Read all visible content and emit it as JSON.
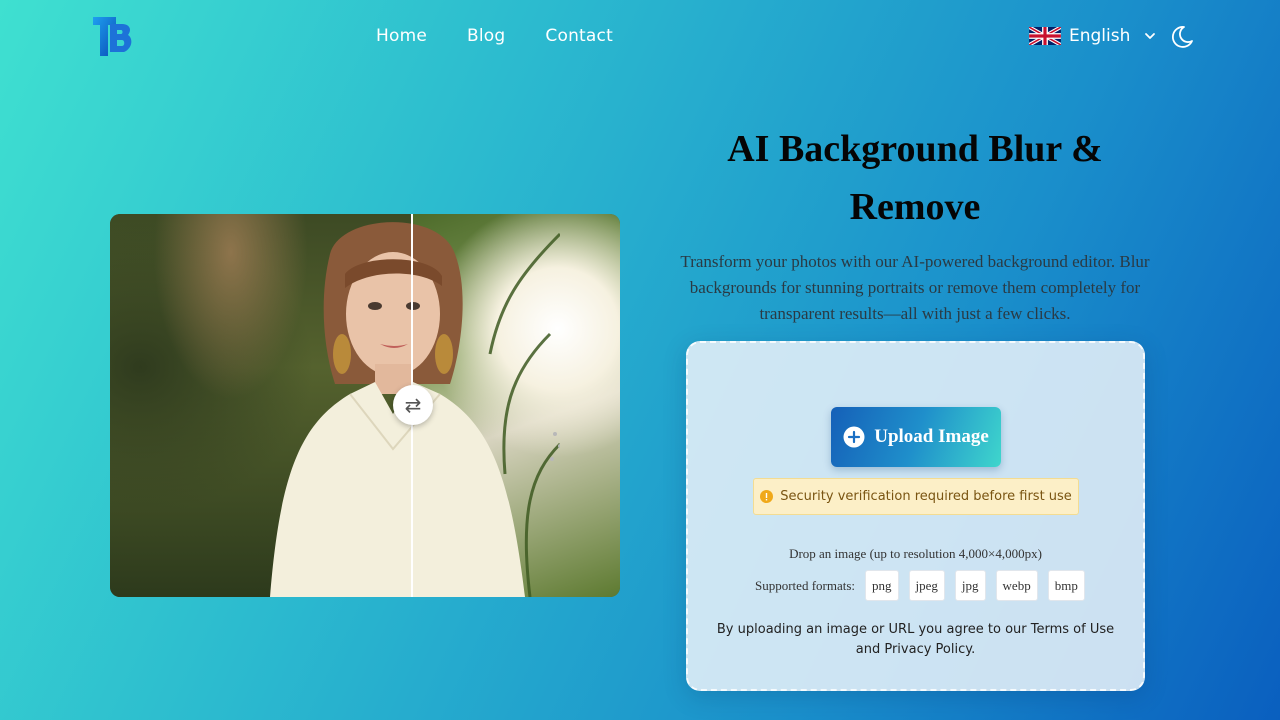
{
  "header": {
    "logo_icon": "tb-logo-icon",
    "nav": [
      {
        "label": "Home"
      },
      {
        "label": "Blog"
      },
      {
        "label": "Contact"
      }
    ],
    "language": {
      "label": "English",
      "flag_icon": "uk-flag-icon"
    },
    "theme_icon": "moon-icon"
  },
  "preview": {
    "swap_icon": "swap-arrows-icon",
    "swap_glyph": "⇄"
  },
  "hero": {
    "title": "AI Background Blur & Remove",
    "description": "Transform your photos with our AI-powered background editor. Blur backgrounds for stunning portraits or remove them completely for transparent results—all with just a few clicks."
  },
  "upload": {
    "button_label": "Upload Image",
    "warning": "Security verification required before first use",
    "drop_text": "Drop an image (up to resolution 4,000×4,000px)",
    "formats_label": "Supported formats:",
    "formats": [
      "png",
      "jpeg",
      "jpg",
      "webp",
      "bmp"
    ],
    "terms": "By uploading an image or URL you agree to our Terms of Use and Privacy Policy."
  },
  "colors": {
    "accent_start": "#1560b8",
    "accent_end": "#3fd6cc",
    "warning_bg": "#fcefc7",
    "warning_text": "#7a5512"
  }
}
